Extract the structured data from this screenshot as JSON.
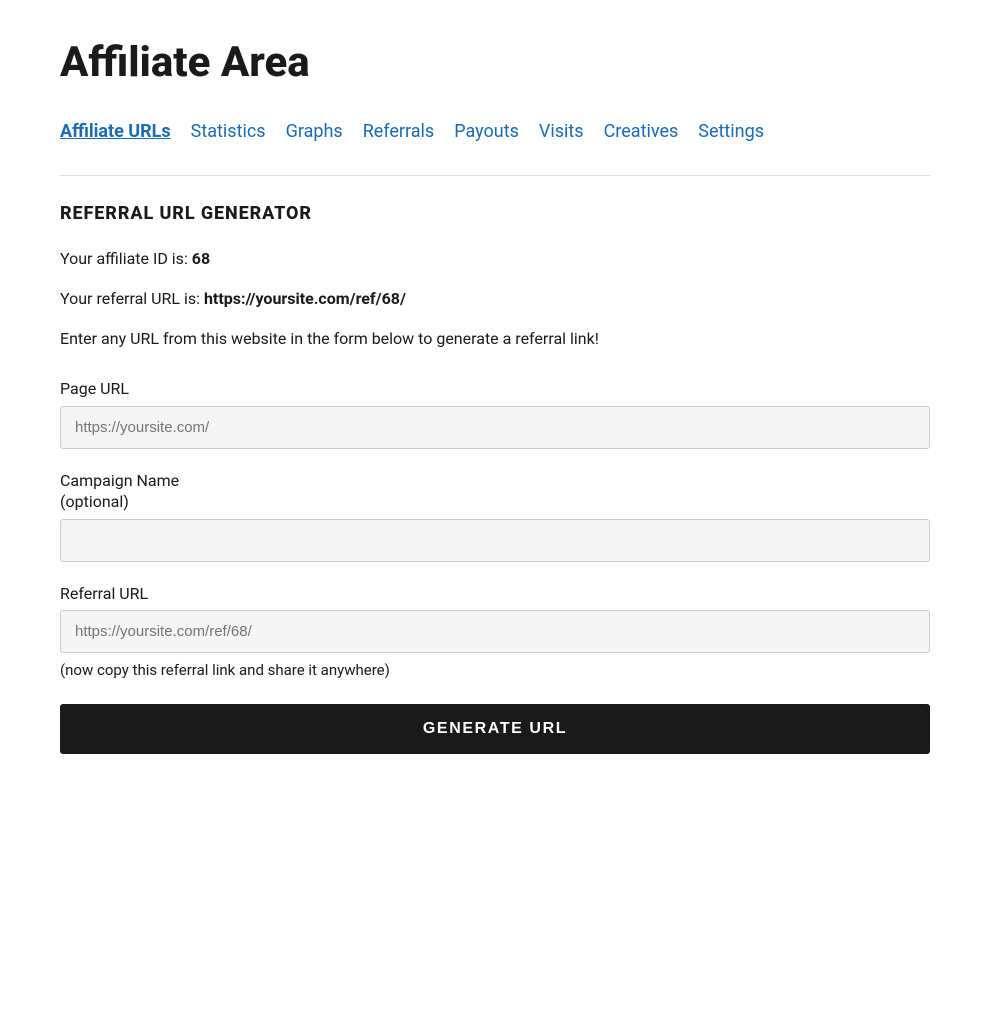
{
  "page": {
    "title": "Affiliate Area"
  },
  "nav": {
    "tabs": [
      {
        "id": "affiliate-urls",
        "label": "Affiliate URLs",
        "active": true
      },
      {
        "id": "statistics",
        "label": "Statistics",
        "active": false
      },
      {
        "id": "graphs",
        "label": "Graphs",
        "active": false
      },
      {
        "id": "referrals",
        "label": "Referrals",
        "active": false
      },
      {
        "id": "payouts",
        "label": "Payouts",
        "active": false
      },
      {
        "id": "visits",
        "label": "Visits",
        "active": false
      },
      {
        "id": "creatives",
        "label": "Creatives",
        "active": false
      },
      {
        "id": "settings",
        "label": "Settings",
        "active": false
      }
    ]
  },
  "content": {
    "section_title": "REFERRAL URL GENERATOR",
    "affiliate_id_label": "Your affiliate ID is: ",
    "affiliate_id_value": "68",
    "referral_url_label": "Your referral URL is: ",
    "referral_url_value": "https://yoursite.com/ref/68/",
    "description": "Enter any URL from this website in the form below to generate a referral link!",
    "form": {
      "page_url_label": "Page URL",
      "page_url_placeholder": "https://yoursite.com/",
      "campaign_name_label": "Campaign Name\n(optional)",
      "campaign_name_placeholder": "",
      "referral_url_label": "Referral URL",
      "referral_url_placeholder": "https://yoursite.com/ref/68/",
      "referral_url_hint": "(now copy this referral link and share it anywhere)",
      "generate_button": "GENERATE URL"
    }
  }
}
